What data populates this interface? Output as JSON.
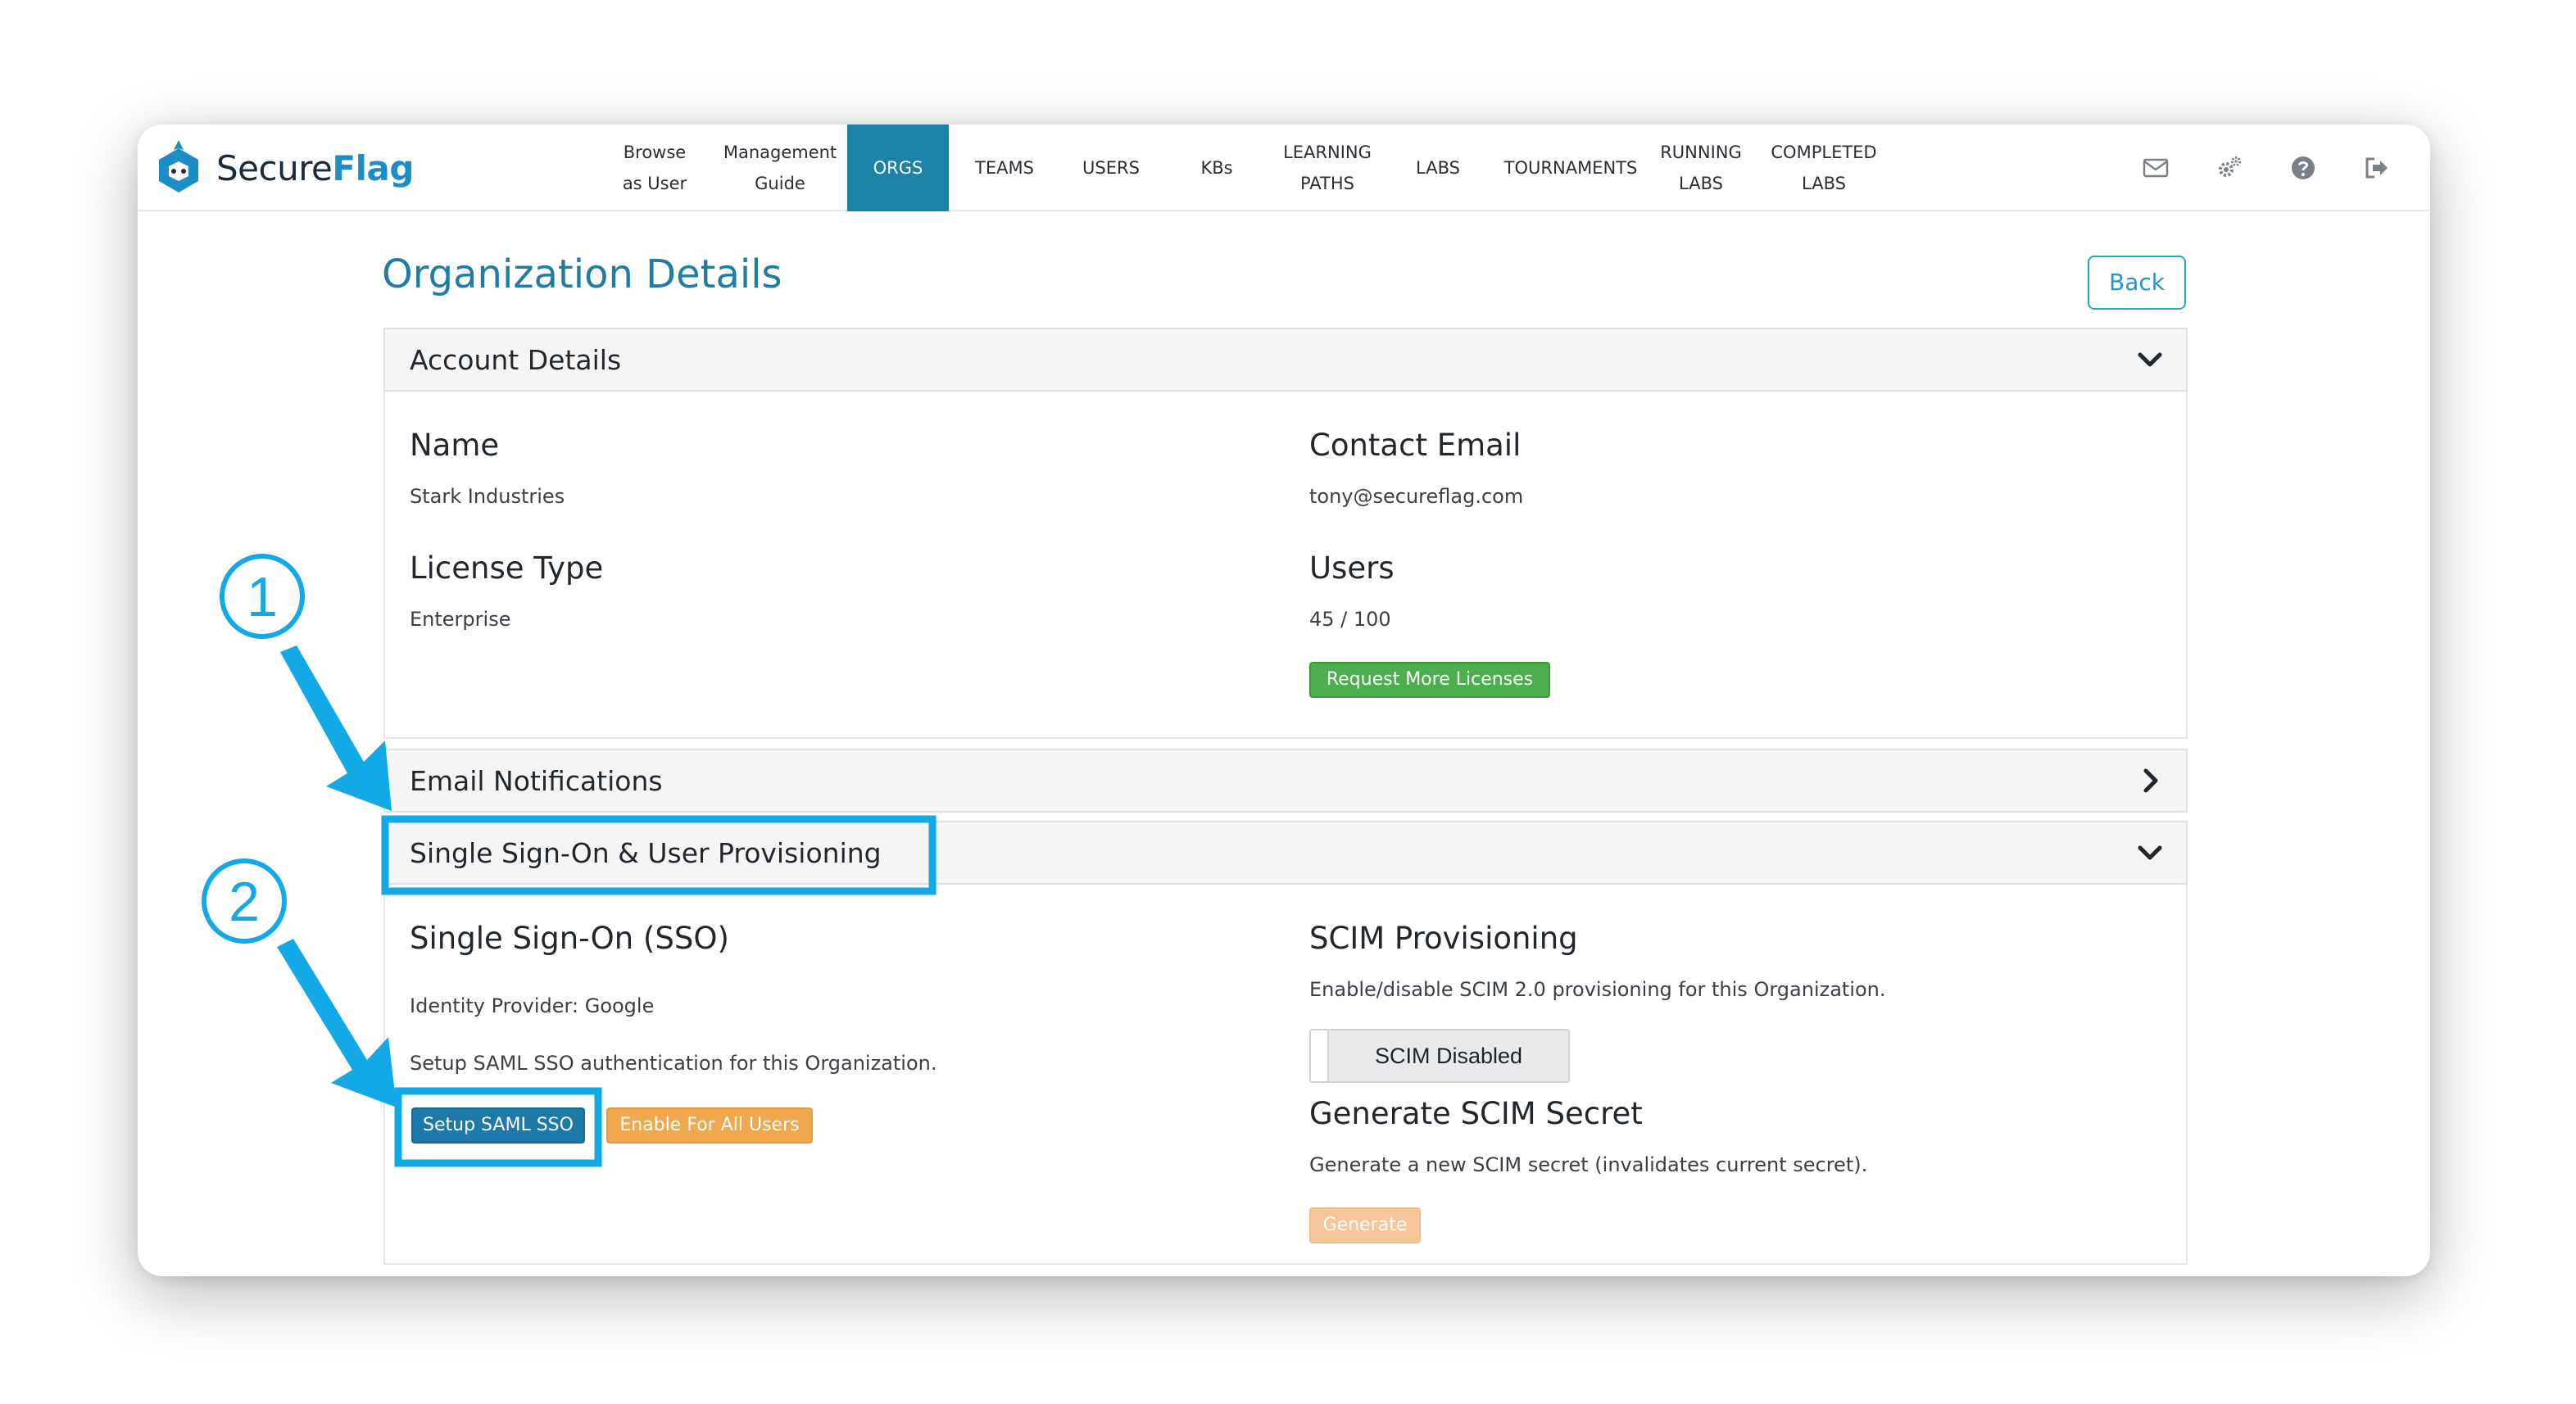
{
  "app": {
    "logo_secure": "Secure",
    "logo_flag": "Flag"
  },
  "nav": {
    "items": [
      {
        "key": "browse",
        "line1": "Browse",
        "line2": "as User",
        "active": false
      },
      {
        "key": "guide",
        "line1": "Management",
        "line2": "Guide",
        "active": false
      },
      {
        "key": "orgs",
        "line1": "ORGS",
        "line2": "",
        "active": true
      },
      {
        "key": "teams",
        "line1": "TEAMS",
        "line2": "",
        "active": false
      },
      {
        "key": "users",
        "line1": "USERS",
        "line2": "",
        "active": false
      },
      {
        "key": "kbs",
        "line1": "KBs",
        "line2": "",
        "active": false
      },
      {
        "key": "paths",
        "line1": "LEARNING",
        "line2": "PATHS",
        "active": false
      },
      {
        "key": "labs",
        "line1": "LABS",
        "line2": "",
        "active": false
      },
      {
        "key": "tournaments",
        "line1": "TOURNAMENTS",
        "line2": "",
        "active": false
      },
      {
        "key": "running",
        "line1": "RUNNING",
        "line2": "LABS",
        "active": false
      },
      {
        "key": "completed",
        "line1": "COMPLETED",
        "line2": "LABS",
        "active": false
      }
    ],
    "icons": [
      "envelope-icon",
      "gears-icon",
      "help-icon",
      "logout-icon"
    ]
  },
  "page": {
    "title": "Organization Details",
    "back_label": "Back"
  },
  "account": {
    "header": "Account Details",
    "name_label": "Name",
    "name_value": "Stark Industries",
    "email_label": "Contact Email",
    "email_value": "tony@secureflag.com",
    "license_label": "License Type",
    "license_value": "Enterprise",
    "users_label": "Users",
    "users_value": "45 / 100",
    "request_label": "Request More Licenses"
  },
  "email_notifications": {
    "header": "Email Notifications"
  },
  "sso": {
    "header": "Single Sign-On & User Provisioning",
    "sso_title": "Single Sign-On (SSO)",
    "idp_text": "Identity Provider: Google",
    "setup_text": "Setup SAML SSO authentication for this Organization.",
    "setup_button": "Setup SAML SSO",
    "enable_button": "Enable For All Users",
    "scim_title": "SCIM Provisioning",
    "scim_text": "Enable/disable SCIM 2.0 provisioning for this Organization.",
    "scim_toggle": "SCIM Disabled",
    "secret_title": "Generate SCIM Secret",
    "secret_text": "Generate a new SCIM secret (invalidates current secret).",
    "generate_button": "Generate"
  },
  "annotations": {
    "step1": "1",
    "step2": "2"
  },
  "colors": {
    "accent": "#1d82a7",
    "annotation": "#12a9e6",
    "success": "#4cae4c",
    "warning": "#f0a84e"
  }
}
